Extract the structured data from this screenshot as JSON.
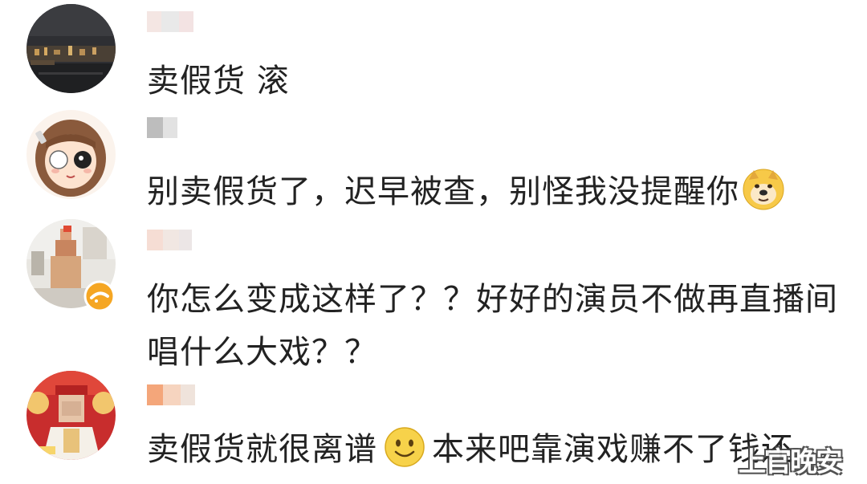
{
  "comments": [
    {
      "text": "卖假货 滚",
      "avatar_icon": "city-night-avatar-icon",
      "username_colors": [
        "#f4e6e3",
        "#e9e9e9",
        "#f3e3e3"
      ]
    },
    {
      "text": "别卖假货了，迟早被查，别怪我没提醒你",
      "avatar_icon": "cartoon-girl-avatar-icon",
      "emoji_icon": "doge-emoji-icon",
      "username_colors": [
        "#bdbdbd",
        "#e2e2e2"
      ]
    },
    {
      "text": "你怎么变成这样了？？好好的演员不做再直播间唱什么大戏？？",
      "avatar_icon": "blurred-person-avatar-icon",
      "badge_icon": "verified-badge-icon",
      "username_colors": [
        "#f6ddd4",
        "#f1e7e2",
        "#ece6e6"
      ]
    },
    {
      "text_before": "卖假货就很离谱",
      "emoji_icon": "smile-emoji-icon",
      "text_after": "本来吧靠演戏赚不了钱还",
      "avatar_icon": "red-festival-avatar-icon",
      "username_colors": [
        "#f4a67a",
        "#f6d4bf",
        "#efe3db"
      ]
    }
  ],
  "watermark": "上官晚安",
  "colors": {
    "text": "#222222",
    "background": "#ffffff",
    "badge": "#f5a623",
    "emoji_yellow": "#f7c948"
  }
}
